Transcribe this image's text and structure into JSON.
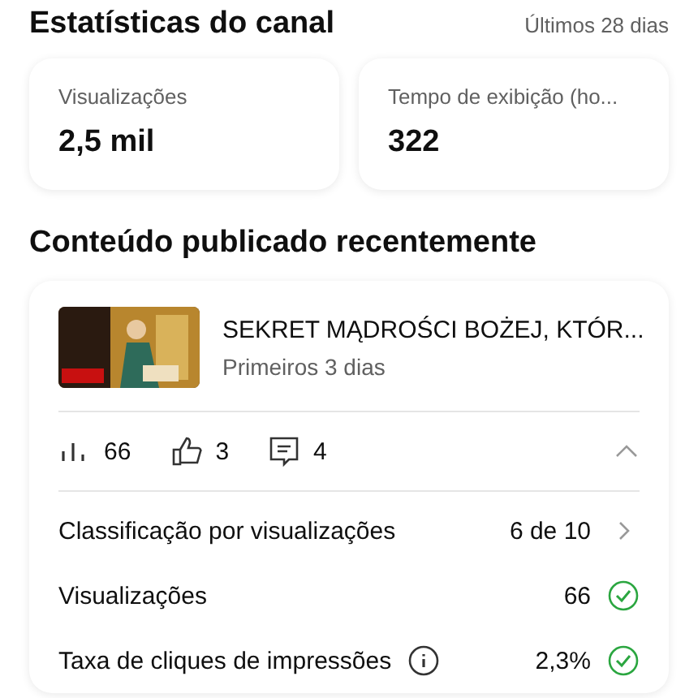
{
  "header": {
    "title": "Estatísticas do canal",
    "period": "Últimos 28 dias"
  },
  "stat_cards": [
    {
      "label": "Visualizações",
      "value": "2,5 mil"
    },
    {
      "label": "Tempo de exibição (ho...",
      "value": "322"
    }
  ],
  "recent": {
    "title": "Conteúdo publicado recentemente",
    "video": {
      "title": "SEKRET MĄDROŚCI BOŻEJ, KTÓR...",
      "subtitle": "Primeiros 3 dias"
    },
    "counts": [
      {
        "kind": "views",
        "value": "66"
      },
      {
        "kind": "likes",
        "value": "3"
      },
      {
        "kind": "comments",
        "value": "4"
      }
    ],
    "expanded": true,
    "rows": [
      {
        "kind": "rank",
        "label": "Classificação por visualizações",
        "value": "6 de 10",
        "info": false
      },
      {
        "kind": "check",
        "label": "Visualizações",
        "value": "66",
        "info": false
      },
      {
        "kind": "check",
        "label": "Taxa de cliques de impressões",
        "value": "2,3%",
        "info": true
      }
    ]
  }
}
